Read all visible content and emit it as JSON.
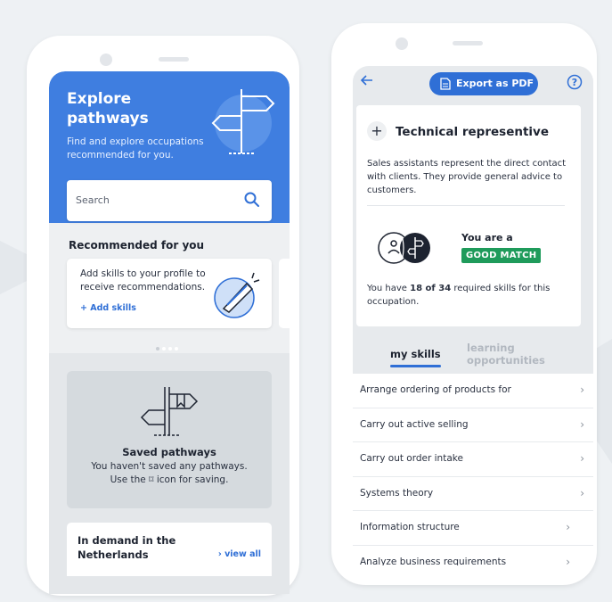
{
  "explore": {
    "title": "Explore pathways",
    "subtitle": "Find and explore occupations recommended for you.",
    "search_placeholder": "Search",
    "recommended_title": "Recommended for you",
    "recommend_card_text": "Add skills to your profile to receive recommendations.",
    "add_skills_label": "+ Add skills",
    "carousel_dots": 4,
    "saved": {
      "title": "Saved pathways",
      "line1": "You haven't saved any pathways.",
      "line2": "Use the ⌑ icon for saving."
    },
    "demand_title": "In demand in the Netherlands",
    "view_all_label": "›  view all"
  },
  "detail": {
    "back_icon": "arrow-left-icon",
    "export_label": "Export as PDF",
    "help_icon": "question-circle-icon",
    "occupation_title": "Technical representive",
    "description": "Sales assistants represent the direct contact with clients. They provide general advice to customers.",
    "match_prefix": "You are a",
    "match_badge": "GOOD MATCH",
    "skills_have": "18 of 34",
    "skills_text_before": "You have ",
    "skills_text_after": " required skills for this occupation.",
    "tabs": [
      "my skills",
      "learning opportunities"
    ],
    "skills": [
      "Arrange ordering of products for",
      "Carry out active selling",
      "Carry out order intake",
      "Systems theory",
      "Information structure",
      "Analyze business requirements"
    ],
    "colors": {
      "primary": "#3f7ee0",
      "accent": "#2f6fd6",
      "match": "#1f9b5b"
    }
  }
}
